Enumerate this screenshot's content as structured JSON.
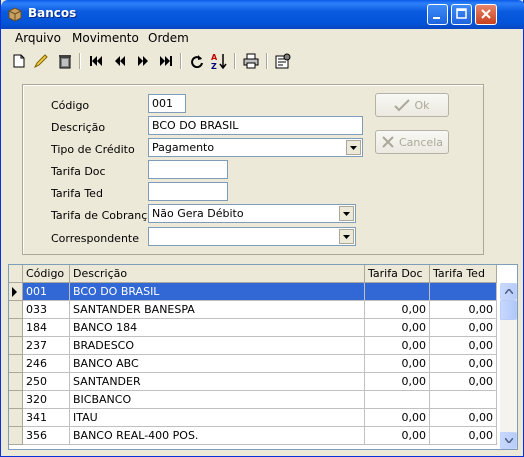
{
  "window": {
    "title": "Bancos"
  },
  "menu": [
    "Arquivo",
    "Movimento",
    "Ordem"
  ],
  "toolbar": [
    "new-icon",
    "edit-icon",
    "delete-icon",
    "first-icon",
    "prev-icon",
    "next-icon",
    "last-icon",
    "refresh-icon",
    "sort-icon",
    "print-icon",
    "properties-icon"
  ],
  "form": {
    "codigo_label": "Código",
    "codigo_value": "001",
    "descricao_label": "Descrição",
    "descricao_value": "BCO DO BRASIL",
    "tipo_label": "Tipo de Crédito",
    "tipo_value": "Pagamento",
    "tarifa_doc_label": "Tarifa Doc",
    "tarifa_doc_value": "",
    "tarifa_ted_label": "Tarifa Ted",
    "tarifa_ted_value": "",
    "tarifa_cobranca_label": "Tarifa de Cobrança",
    "tarifa_cobranca_value": "Não Gera Débito",
    "correspondente_label": "Correspondente",
    "correspondente_value": ""
  },
  "buttons": {
    "ok": "Ok",
    "cancel": "Cancela"
  },
  "grid": {
    "columns": [
      "Código",
      "Descrição",
      "Tarifa Doc",
      "Tarifa Ted"
    ],
    "rows": [
      {
        "codigo": "001",
        "descricao": "BCO DO BRASIL",
        "doc": "",
        "ted": ""
      },
      {
        "codigo": "033",
        "descricao": "SANTANDER BANESPA",
        "doc": "0,00",
        "ted": "0,00"
      },
      {
        "codigo": "184",
        "descricao": "BANCO 184",
        "doc": "0,00",
        "ted": "0,00"
      },
      {
        "codigo": "237",
        "descricao": "BRADESCO",
        "doc": "0,00",
        "ted": "0,00"
      },
      {
        "codigo": "246",
        "descricao": "BANCO ABC",
        "doc": "0,00",
        "ted": "0,00"
      },
      {
        "codigo": "250",
        "descricao": "SANTANDER",
        "doc": "0,00",
        "ted": "0,00"
      },
      {
        "codigo": "320",
        "descricao": "BICBANCO",
        "doc": "",
        "ted": ""
      },
      {
        "codigo": "341",
        "descricao": "ITAU",
        "doc": "0,00",
        "ted": "0,00"
      },
      {
        "codigo": "356",
        "descricao": "BANCO REAL-400 POS.",
        "doc": "0,00",
        "ted": "0,00"
      }
    ]
  }
}
